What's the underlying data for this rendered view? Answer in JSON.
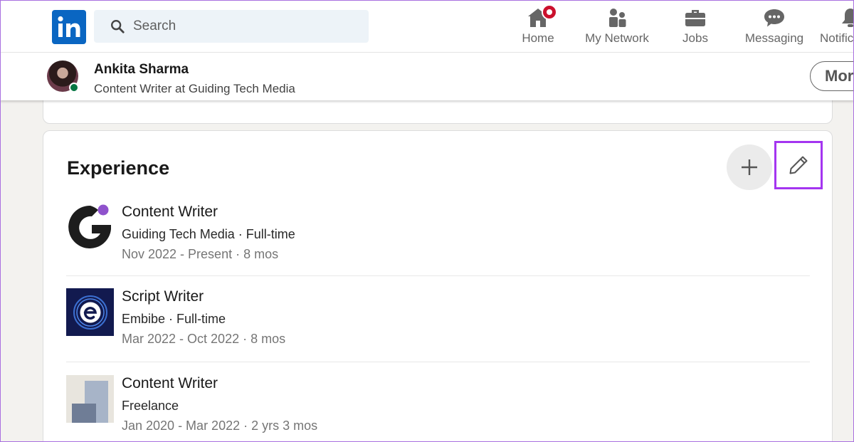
{
  "nav": {
    "logo_text": "in",
    "search_placeholder": "Search",
    "items": [
      {
        "label": "Home",
        "icon": "home-icon",
        "badge": true
      },
      {
        "label": "My Network",
        "icon": "network-icon"
      },
      {
        "label": "Jobs",
        "icon": "briefcase-icon"
      },
      {
        "label": "Messaging",
        "icon": "chat-icon"
      },
      {
        "label": "Notifications",
        "icon": "bell-icon"
      }
    ]
  },
  "profile_bar": {
    "name": "Ankita Sharma",
    "headline": "Content Writer at Guiding Tech Media",
    "more_label": "More"
  },
  "experience": {
    "title": "Experience",
    "add_icon": "plus-icon",
    "edit_icon": "pencil-icon",
    "items": [
      {
        "title": "Content Writer",
        "company": "Guiding Tech Media · Full-time",
        "dates": "Nov 2022 - Present · 8 mos",
        "logo": "guiding-tech-logo"
      },
      {
        "title": "Script Writer",
        "company": "Embibe · Full-time",
        "dates": "Mar 2022 - Oct 2022 · 8 mos",
        "logo": "embibe-logo"
      },
      {
        "title": "Content Writer",
        "company": "Freelance",
        "dates": "Jan 2020 - Mar 2022 · 2 yrs 3 mos",
        "logo": "freelance-logo"
      }
    ]
  },
  "colors": {
    "linkedin_blue": "#0a66c2",
    "highlight_purple": "#a435f0",
    "badge_red": "#cb112d",
    "online_green": "#057642"
  }
}
